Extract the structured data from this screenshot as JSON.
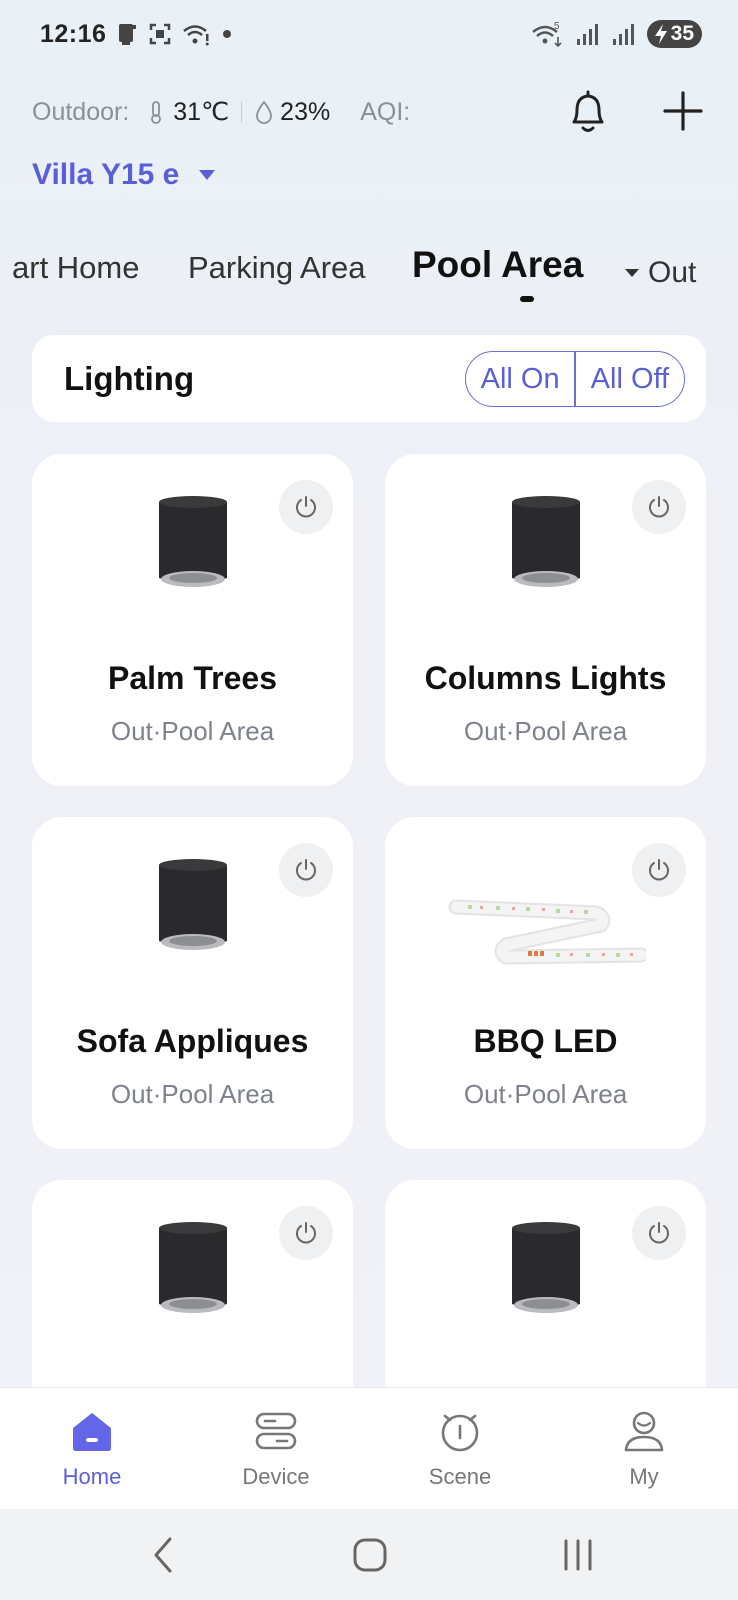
{
  "status_bar": {
    "time": "12:16",
    "battery": "35",
    "icons": [
      "notification-icon",
      "screenshot-icon",
      "wifi-question-icon",
      "dot-icon",
      "wifi-5-icon",
      "signal-icon",
      "signal-icon",
      "battery-charging-icon"
    ]
  },
  "header": {
    "outdoor_label": "Outdoor:",
    "temperature": "31℃",
    "humidity": "23%",
    "aqi_label": "AQI:",
    "icons": [
      "thermometer-icon",
      "droplet-icon",
      "bell-icon",
      "plus-icon"
    ]
  },
  "home": {
    "name": "Villa Y15 e",
    "dropdown_icon": "caret-down-icon"
  },
  "room_tabs": [
    {
      "label": "art Home"
    },
    {
      "label": "Parking Area"
    },
    {
      "label": "Pool Area",
      "active": true
    },
    {
      "label": "Out",
      "icon": "caret-down-icon"
    }
  ],
  "category": {
    "title": "Lighting",
    "all_on": "All On",
    "all_off": "All Off"
  },
  "devices": [
    {
      "name": "Palm Trees",
      "location": "Out·Pool Area",
      "type": "downlight"
    },
    {
      "name": "Columns Lights",
      "location": "Out·Pool Area",
      "type": "downlight"
    },
    {
      "name": "Sofa Appliques",
      "location": "Out·Pool Area",
      "type": "downlight"
    },
    {
      "name": "BBQ LED",
      "location": "Out·Pool Area",
      "type": "led-strip"
    },
    {
      "name": "",
      "location": "",
      "type": "downlight"
    },
    {
      "name": "",
      "location": "",
      "type": "downlight"
    }
  ],
  "bottom_nav": [
    {
      "label": "Home",
      "icon": "home-icon",
      "active": true
    },
    {
      "label": "Device",
      "icon": "device-icon"
    },
    {
      "label": "Scene",
      "icon": "scene-icon"
    },
    {
      "label": "My",
      "icon": "profile-icon"
    }
  ],
  "colors": {
    "accent": "#5b5fd6",
    "text_primary": "#111111",
    "text_secondary": "#7e828c",
    "card_bg": "#ffffff",
    "page_bg": "#eef0f6"
  }
}
